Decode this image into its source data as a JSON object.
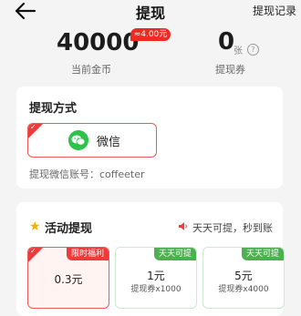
{
  "header": {
    "title": "提现",
    "record_label": "提现记录"
  },
  "balance": {
    "coins": "40000",
    "coins_badge": "≈4.00元",
    "coins_label": "当前金币",
    "vouchers": "0",
    "voucher_unit": "张",
    "help_glyph": "?",
    "voucher_label": "提现券"
  },
  "method_card": {
    "title": "提现方式",
    "selected_method": "微信",
    "account_label": "提现微信账号：coffeeter"
  },
  "activity_card": {
    "title": "活动提现",
    "notice": "天天可提，秒到账",
    "options": [
      {
        "tag": "限时福利",
        "amount": "0.3元",
        "sub": "",
        "selected": true
      },
      {
        "tag": "天天可提",
        "amount": "1元",
        "sub": "提现券x1000",
        "selected": false
      },
      {
        "tag": "天天可提",
        "amount": "5元",
        "sub": "提现券x4000",
        "selected": false
      }
    ]
  },
  "colors": {
    "accent_red": "#ee3a3a",
    "wechat_green": "#2dc24a",
    "tag_green": "#4cb050",
    "star_yellow": "#f3b100"
  },
  "icons": [
    "back-arrow-icon",
    "help-icon",
    "wechat-icon",
    "star-icon",
    "speaker-icon",
    "check-icon"
  ]
}
